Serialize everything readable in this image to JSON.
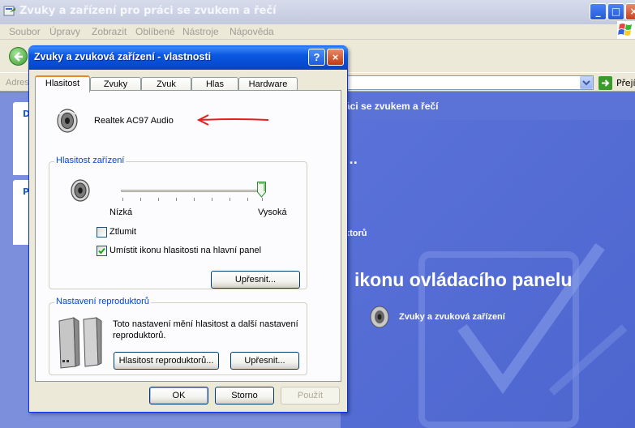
{
  "background_window": {
    "title": "Zvuky a zařízení pro práci se zvukem a řečí",
    "controls": [
      "_",
      "□",
      "×"
    ],
    "menu": [
      "Soubor",
      "Úpravy",
      "Zobrazit",
      "Oblíbené",
      "Nástroje",
      "Nápověda"
    ],
    "address_label": "Adres",
    "go_label": "Přejí",
    "left_tasks": [
      "D",
      "P"
    ],
    "main_header": "áci se zvukem a řečí",
    "ellipsis": "...",
    "category_link": "ktorů",
    "big_title": "ikonu ovládacího panelu",
    "cpl_item": "Zvuky a zvuková zařízení"
  },
  "dialog": {
    "title": "Zvuky a zvuková zařízení - vlastnosti",
    "help_btn": "?",
    "close_btn": "×",
    "tabs": [
      "Hlasitost",
      "Zvuky",
      "Zvuk",
      "Hlas",
      "Hardware"
    ],
    "active_tab": "Hlasitost",
    "device_name": "Realtek AC97 Audio",
    "device_volume": {
      "group_title": "Hlasitost zařízení",
      "low_label": "Nízká",
      "high_label": "Vysoká",
      "slider_level": 1.0,
      "mute_label": "Ztlumit",
      "mute_checked": false,
      "tray_icon_label": "Umístit ikonu hlasitosti na hlavní panel",
      "tray_icon_checked": true,
      "advanced_btn": "Upřesnit..."
    },
    "speaker_settings": {
      "group_title": "Nastavení reproduktorů",
      "description": "Toto nastavení mění hlasitost a další nastavení reproduktorů.",
      "speaker_volume_btn": "Hlasitost reproduktorů...",
      "advanced_btn": "Upřesnit..."
    },
    "footer": {
      "ok": "OK",
      "cancel": "Storno",
      "apply": "Použít"
    }
  },
  "colors": {
    "xp_blue": "#0a58e1",
    "accent_orange": "#e68b2c",
    "annotation_red": "#e02020",
    "group_title_blue": "#0046d5"
  }
}
